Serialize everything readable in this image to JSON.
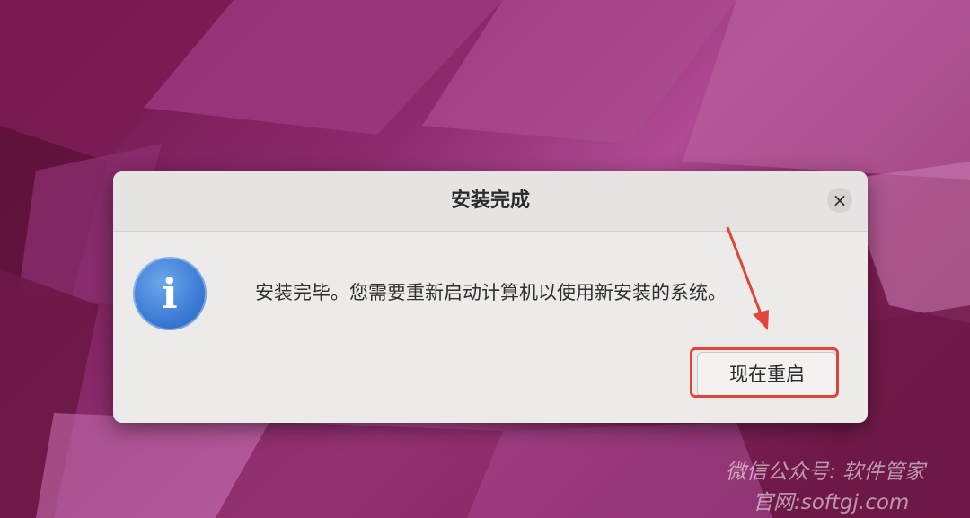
{
  "dialog": {
    "title": "安装完成",
    "close_glyph": "×",
    "icon": "info-icon",
    "icon_glyph": "i",
    "message": "安装完毕。您需要重新启动计算机以使用新安装的系统。",
    "restart_button_label": "现在重启"
  },
  "annotation": {
    "highlight_color": "#e0443a"
  },
  "watermark": {
    "line1": "微信公众号: 软件管家",
    "line2": "官网:softgj.com"
  },
  "colors": {
    "info_blue": "#3a7bd5",
    "dialog_bg": "#ecebe9"
  }
}
